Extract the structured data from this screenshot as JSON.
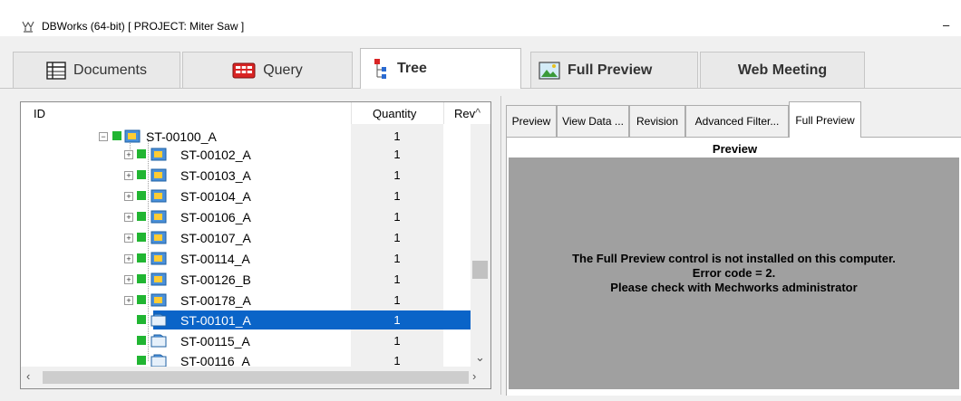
{
  "window": {
    "title": "DBWorks (64-bit) [ PROJECT: Miter Saw ]",
    "minimize": "–"
  },
  "tabs": [
    {
      "label": "Documents",
      "icon": "documents-icon"
    },
    {
      "label": "Query",
      "icon": "query-icon"
    },
    {
      "label": "Tree",
      "icon": "tree-icon",
      "active": true
    },
    {
      "label": "Full Preview",
      "icon": "full-preview-icon"
    },
    {
      "label": "Web Meeting",
      "icon": ""
    }
  ],
  "tree": {
    "columns": {
      "id": "ID",
      "quantity": "Quantity",
      "rev": "Rev"
    },
    "rows": [
      {
        "name": "ST-00100_A",
        "qty": "1"
      },
      {
        "name": "ST-00102_A",
        "qty": "1"
      },
      {
        "name": "ST-00103_A",
        "qty": "1"
      },
      {
        "name": "ST-00104_A",
        "qty": "1"
      },
      {
        "name": "ST-00106_A",
        "qty": "1"
      },
      {
        "name": "ST-00107_A",
        "qty": "1"
      },
      {
        "name": "ST-00114_A",
        "qty": "1"
      },
      {
        "name": "ST-00126_B",
        "qty": "1"
      },
      {
        "name": "ST-00178_A",
        "qty": "1"
      },
      {
        "name": "ST-00101_A",
        "qty": "1"
      },
      {
        "name": "ST-00115_A",
        "qty": "1"
      },
      {
        "name": "ST-00116_A",
        "qty": "1"
      }
    ],
    "selected": "ST-00101_A"
  },
  "preview_tabs": [
    "Preview",
    "View Data ...",
    "Revision",
    "Advanced Filter...",
    "Full Preview"
  ],
  "preview": {
    "title": "Preview",
    "message_line1": "The Full Preview control is not installed on this computer.",
    "message_line2": "Error code = 2.",
    "message_line3": "Please check with Mechworks administrator"
  },
  "colors": {
    "selection": "#0a64c8",
    "status_ok": "#21b532",
    "preview_bg": "#a0a0a0"
  }
}
